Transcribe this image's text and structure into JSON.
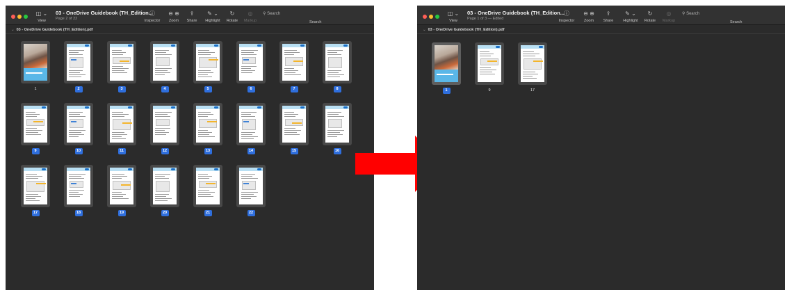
{
  "left_window": {
    "title": "03 - OneDrive Guidebook (TH_Edition...",
    "subtitle": "Page 2 of 22",
    "doc_name": "03 - OneDrive Guidebook (TH_Edition).pdf",
    "toolbar": {
      "view_label": "View",
      "inspector_label": "Inspector",
      "zoom_label": "Zoom",
      "share_label": "Share",
      "highlight_label": "Highlight",
      "rotate_label": "Rotate",
      "markup_label": "Markup",
      "search_placeholder": "Search",
      "search_label": "Search"
    },
    "pages": [
      "1",
      "2",
      "3",
      "4",
      "5",
      "6",
      "7",
      "8",
      "9",
      "10",
      "11",
      "12",
      "13",
      "14",
      "15",
      "16",
      "17",
      "18",
      "19",
      "20",
      "21",
      "22"
    ],
    "selected_pages": [
      "2",
      "3",
      "4",
      "5",
      "6",
      "7",
      "8",
      "9",
      "10",
      "11",
      "12",
      "13",
      "14",
      "15",
      "16",
      "17",
      "18",
      "19",
      "20",
      "21",
      "22"
    ]
  },
  "right_window": {
    "title": "03 - OneDrive Guidebook (TH_Edition...",
    "subtitle": "Page 1 of 3 — Edited",
    "doc_name": "03 - OneDrive Guidebook (TH_Edition).pdf",
    "toolbar": {
      "view_label": "View",
      "inspector_label": "Inspector",
      "zoom_label": "Zoom",
      "share_label": "Share",
      "highlight_label": "Highlight",
      "rotate_label": "Rotate",
      "markup_label": "Markup",
      "search_placeholder": "Search",
      "search_label": "Search"
    },
    "pages": [
      "1",
      "9",
      "17"
    ],
    "selected_pages": [
      "1"
    ]
  },
  "icons": {
    "sidebar": "sidebar-icon",
    "info": "info-icon",
    "zoom_out": "zoom-out-icon",
    "zoom_in": "zoom-in-icon",
    "share": "share-icon",
    "highlight": "highlight-pen-icon",
    "rotate": "rotate-icon",
    "markup": "markup-icon",
    "search": "search-icon"
  },
  "colors": {
    "window_bg": "#2b2b2b",
    "toolbar_bg": "#323232",
    "selection_badge": "#2f6fde",
    "arrow": "#ff0000"
  }
}
